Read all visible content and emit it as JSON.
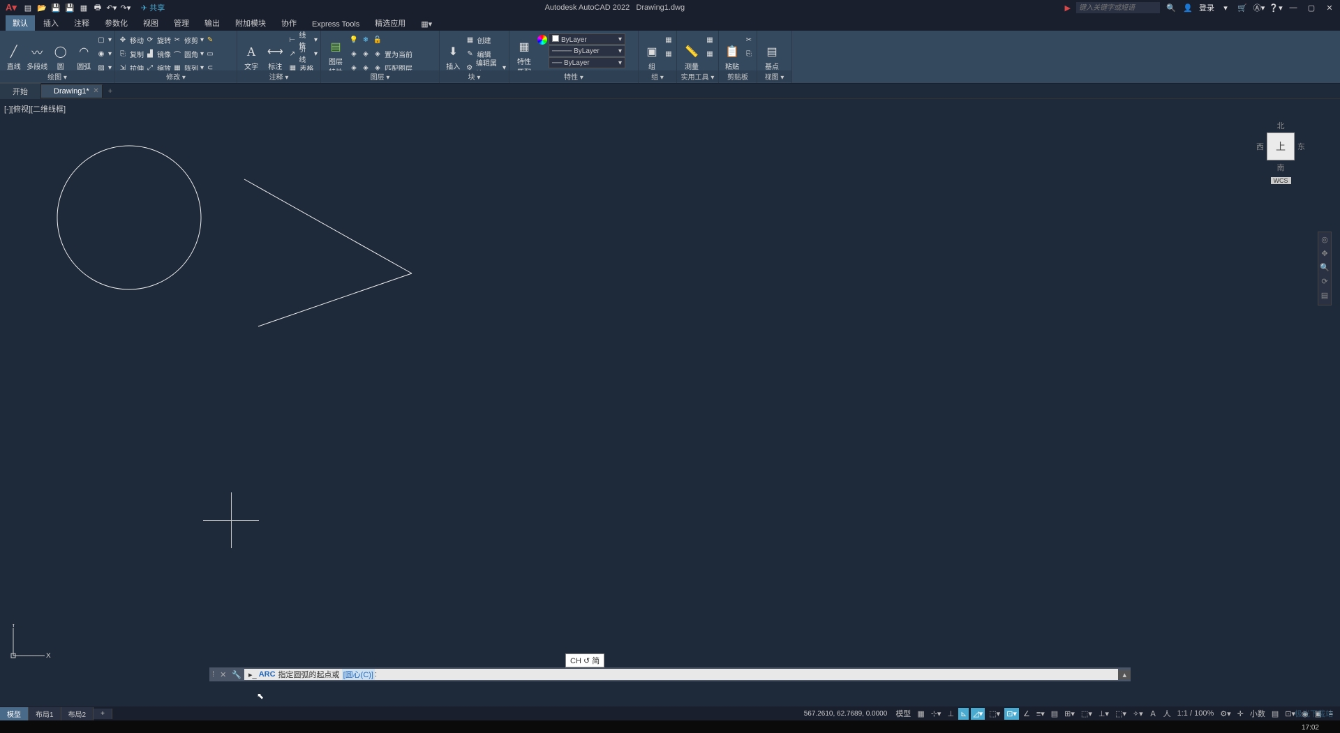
{
  "title": {
    "app": "Autodesk AutoCAD 2022",
    "file": "Drawing1.dwg"
  },
  "titlebar": {
    "share": "共享",
    "search_placeholder": "键入关键字或短语",
    "login": "登录"
  },
  "ribbon_tabs": [
    "默认",
    "插入",
    "注释",
    "参数化",
    "视图",
    "管理",
    "输出",
    "附加模块",
    "协作",
    "Express Tools",
    "精选应用"
  ],
  "panels": {
    "draw": {
      "title": "绘图 ▾",
      "line": "直线",
      "polyline": "多段线",
      "circle": "圆",
      "arc": "圆弧"
    },
    "modify": {
      "title": "修改 ▾",
      "move": "移动",
      "rotate": "旋转",
      "trim": "修剪",
      "copy": "复制",
      "mirror": "镜像",
      "fillet": "圆角",
      "stretch": "拉伸",
      "scale": "缩放",
      "array": "阵列"
    },
    "annot": {
      "title": "注释 ▾",
      "text": "文字",
      "dim": "标注",
      "linear": "线性",
      "leader": "引线",
      "table": "表格"
    },
    "layers": {
      "title": "图层 ▾",
      "props": "图层\n特性",
      "current": "置为当前",
      "match": "匹配图层"
    },
    "block": {
      "title": "块 ▾",
      "insert": "插入",
      "create": "创建",
      "edit": "编辑",
      "attr": "编辑属性"
    },
    "props": {
      "title": "特性 ▾",
      "match": "特性\n匹配",
      "bylayer": "ByLayer"
    },
    "group": {
      "title": "组 ▾",
      "group": "组"
    },
    "util": {
      "title": "实用工具 ▾",
      "measure": "测量"
    },
    "clip": {
      "title": "剪贴板",
      "paste": "粘贴"
    },
    "view": {
      "title": "视图 ▾",
      "base": "基点"
    }
  },
  "file_tabs": {
    "start": "开始",
    "drawing": "Drawing1*"
  },
  "viewport": {
    "label": "[-][俯视][二维线框]"
  },
  "viewcube": {
    "n": "北",
    "s": "南",
    "e": "东",
    "w": "西",
    "top": "上",
    "wcs": "WCS"
  },
  "cmd": {
    "name": "ARC",
    "prompt": "指定圆弧的起点或",
    "option": "[圆心(C)]",
    "colon": ":"
  },
  "ime": "CH ↺ 简",
  "layout_tabs": [
    "模型",
    "布局1",
    "布局2"
  ],
  "status": {
    "coords": "567.2610, 62.7689, 0.0000",
    "model": "模型",
    "scale": "1:1 / 100%",
    "dec": "小数"
  },
  "clock": "17:02",
  "cursor_arrow": "▶"
}
